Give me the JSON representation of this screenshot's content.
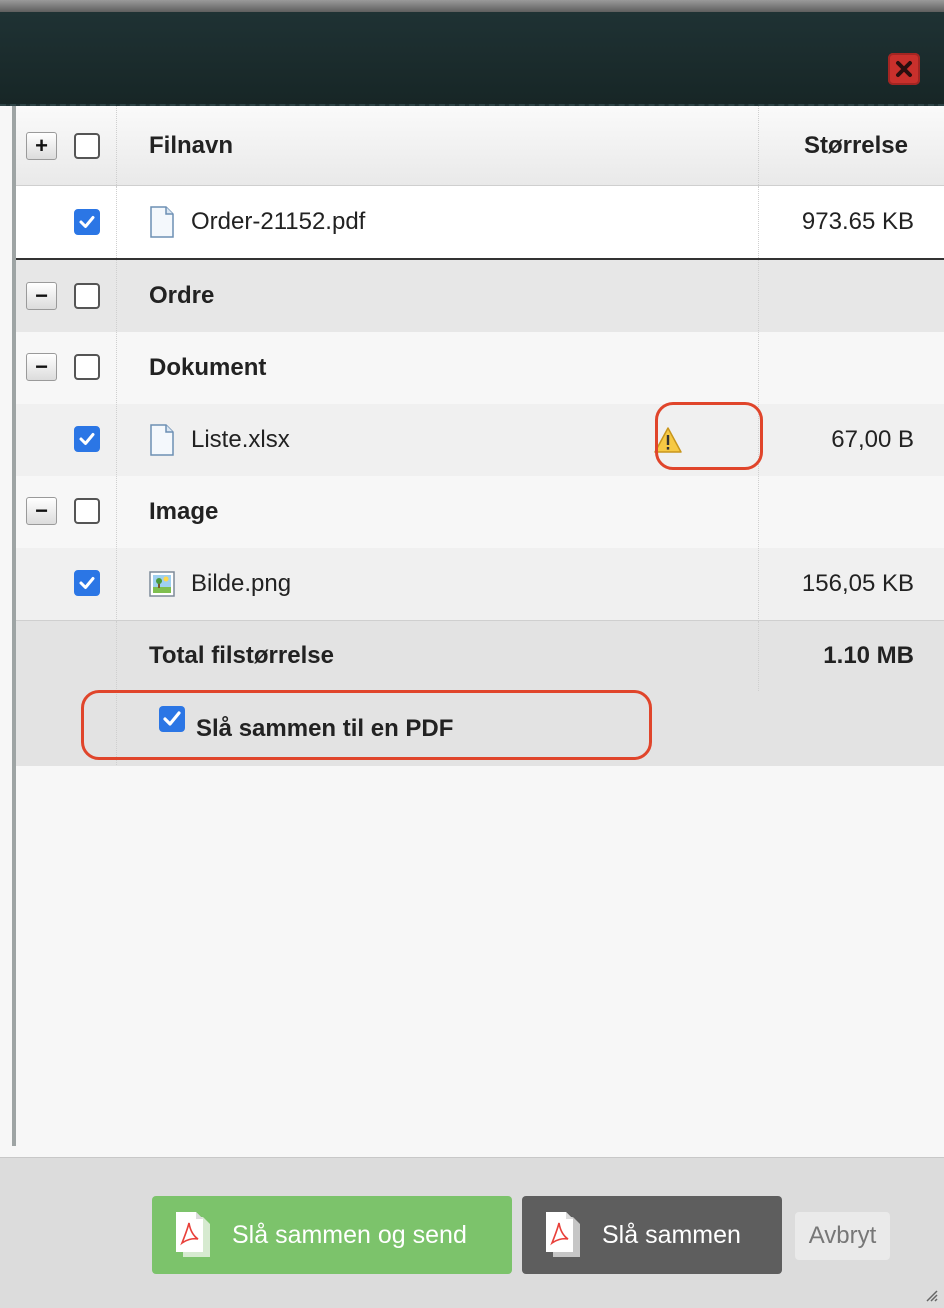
{
  "dialog": {
    "close_icon": "close-x-icon",
    "accent_color": "#c9302c"
  },
  "table": {
    "headers": {
      "name": "Filnavn",
      "size": "Størrelse"
    },
    "rows": [
      {
        "kind": "file",
        "name": "Order-21152.pdf",
        "size": "973.65 KB",
        "checked": true,
        "icon": "document-icon"
      },
      {
        "kind": "group",
        "name": "Ordre",
        "checked": false
      },
      {
        "kind": "group",
        "name": "Dokument",
        "checked": false
      },
      {
        "kind": "file",
        "name": "Liste.xlsx",
        "size": "67,00 B",
        "checked": true,
        "icon": "document-icon",
        "warning": "warning-icon"
      },
      {
        "kind": "group",
        "name": "Image",
        "checked": false
      },
      {
        "kind": "file",
        "name": "Bilde.png",
        "size": "156,05 KB",
        "checked": true,
        "icon": "image-file-icon"
      }
    ],
    "total": {
      "label": "Total filstørrelse",
      "value": "1.10 MB"
    }
  },
  "merge_option": {
    "label": "Slå sammen til en PDF",
    "checked": true
  },
  "footer": {
    "send_button": "Slå sammen og send",
    "merge_button": "Slå sammen",
    "cancel_button": "Avbryt",
    "send_color": "#7cc36b",
    "merge_color": "#5e5e5e"
  }
}
